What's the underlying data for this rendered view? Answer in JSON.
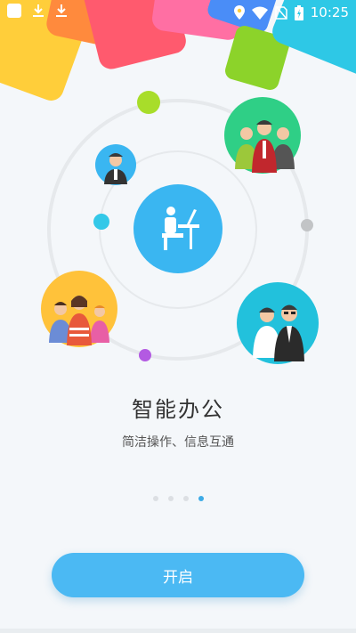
{
  "status_bar": {
    "time": "10:25",
    "left_icons": [
      "app-notification-icon",
      "download-icon",
      "download-icon"
    ],
    "right_icons": [
      "location-icon",
      "wifi-icon",
      "no-sim-icon",
      "battery-charging-icon"
    ]
  },
  "onboarding": {
    "title": "智能办公",
    "subtitle": "简洁操作、信息互通",
    "page_count": 4,
    "active_page": 4
  },
  "start_button": {
    "label": "开启"
  },
  "colors": {
    "accent": "#3dabe6",
    "button": "#4bb9f3",
    "background": "#f4f7fa"
  }
}
